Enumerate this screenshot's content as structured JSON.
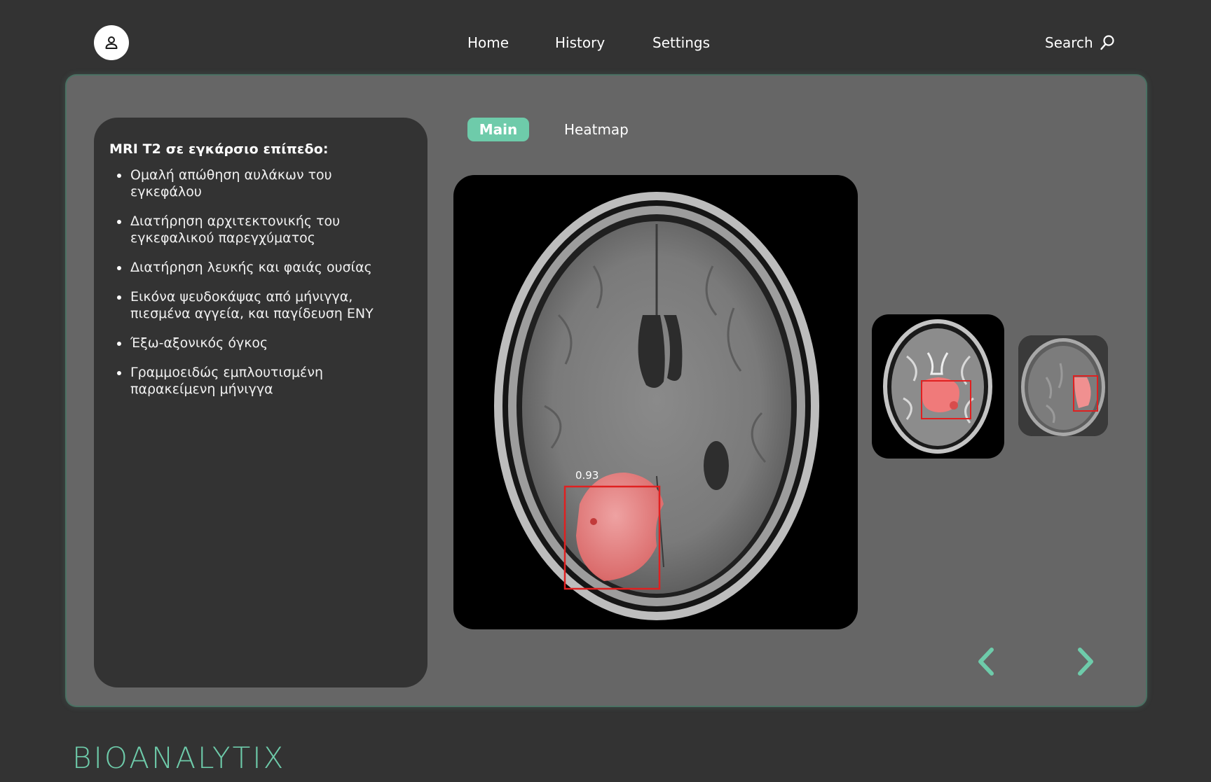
{
  "nav": {
    "items": [
      {
        "label": "Home"
      },
      {
        "label": "History"
      },
      {
        "label": "Settings"
      }
    ],
    "search_label": "Search",
    "user_icon": "user-icon",
    "search_icon": "magnifier-icon"
  },
  "findings": {
    "title": "MRI T2 σε εγκάρσιο επίπεδο:",
    "items": [
      "Ομαλή απώθηση αυλάκων του εγκεφάλου",
      "Διατήρηση αρχιτεκτονικής του εγκεφαλικού παρεγχύματος",
      "Διατήρηση λευκής και φαιάς ουσίας",
      "Εικόνα ψευδοκάψας από μήνιγγα, πιεσμένα αγγεία, και παγίδευση ΕΝΥ",
      "Έξω-αξονικός όγκος",
      "Γραμμοειδώς εμπλουτισμένη παρακείμενη μήνιγγα"
    ]
  },
  "tabs": {
    "main": "Main",
    "heatmap": "Heatmap",
    "active": "Main"
  },
  "viewer": {
    "detection_score": "0.93",
    "prev_icon": "chevron-left-icon",
    "next_icon": "chevron-right-icon"
  },
  "brand": {
    "logo": "BIOANALYTIX",
    "accent": "#6ecbaa",
    "detection_color": "#e02020"
  }
}
